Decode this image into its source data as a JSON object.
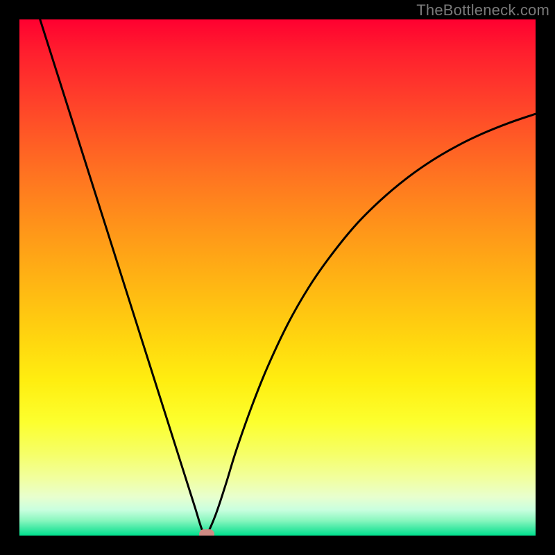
{
  "watermark": "TheBottleneck.com",
  "chart_data": {
    "type": "line",
    "title": "",
    "xlabel": "",
    "ylabel": "",
    "xlim": [
      0,
      100
    ],
    "ylim": [
      0,
      100
    ],
    "grid": false,
    "series": [
      {
        "name": "bottleneck-curve",
        "x": [
          4.0,
          8.0,
          12.0,
          16.0,
          20.0,
          24.0,
          28.0,
          32.0,
          34.0,
          35.5,
          36.3,
          38.0,
          40.0,
          42.0,
          45.0,
          48.0,
          52.0,
          56.0,
          60.0,
          65.0,
          70.0,
          75.0,
          80.0,
          85.0,
          90.0,
          95.0,
          100.0
        ],
        "values": [
          100.0,
          87.4,
          74.8,
          62.2,
          49.6,
          37.0,
          24.4,
          11.8,
          5.5,
          0.8,
          0.3,
          4.0,
          10.0,
          16.5,
          25.0,
          32.5,
          41.0,
          48.0,
          53.8,
          60.0,
          65.0,
          69.2,
          72.7,
          75.6,
          78.0,
          80.0,
          81.7
        ]
      }
    ],
    "marker": {
      "x": 36.3,
      "y": 0.3
    },
    "colors": {
      "gradient_top": "#ff0030",
      "gradient_mid": "#ffd60f",
      "gradient_bottom": "#00e18e",
      "curve": "#000000",
      "marker": "#cf8b84",
      "frame": "#000000"
    }
  }
}
